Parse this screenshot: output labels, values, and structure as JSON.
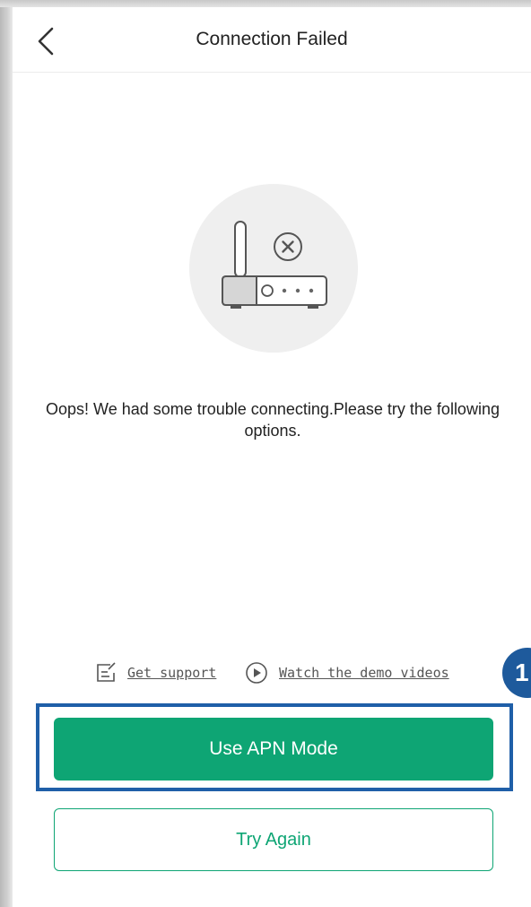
{
  "header": {
    "title": "Connection Failed",
    "back_icon": "chevron-left-icon"
  },
  "illustration": {
    "icon": "router-error-icon"
  },
  "message": "Oops! We had some trouble connecting.Please try the following options.",
  "links": {
    "support": {
      "label": "Get support",
      "icon": "edit-note-icon"
    },
    "demo": {
      "label": "Watch the demo videos",
      "icon": "play-circle-icon"
    }
  },
  "buttons": {
    "apn_label": "Use APN Mode",
    "retry_label": "Try Again"
  },
  "annotation": {
    "step_number": "1"
  },
  "colors": {
    "accent_green": "#0ea574",
    "highlight_blue": "#1f5fa8",
    "badge_blue": "#1e5a9c"
  }
}
